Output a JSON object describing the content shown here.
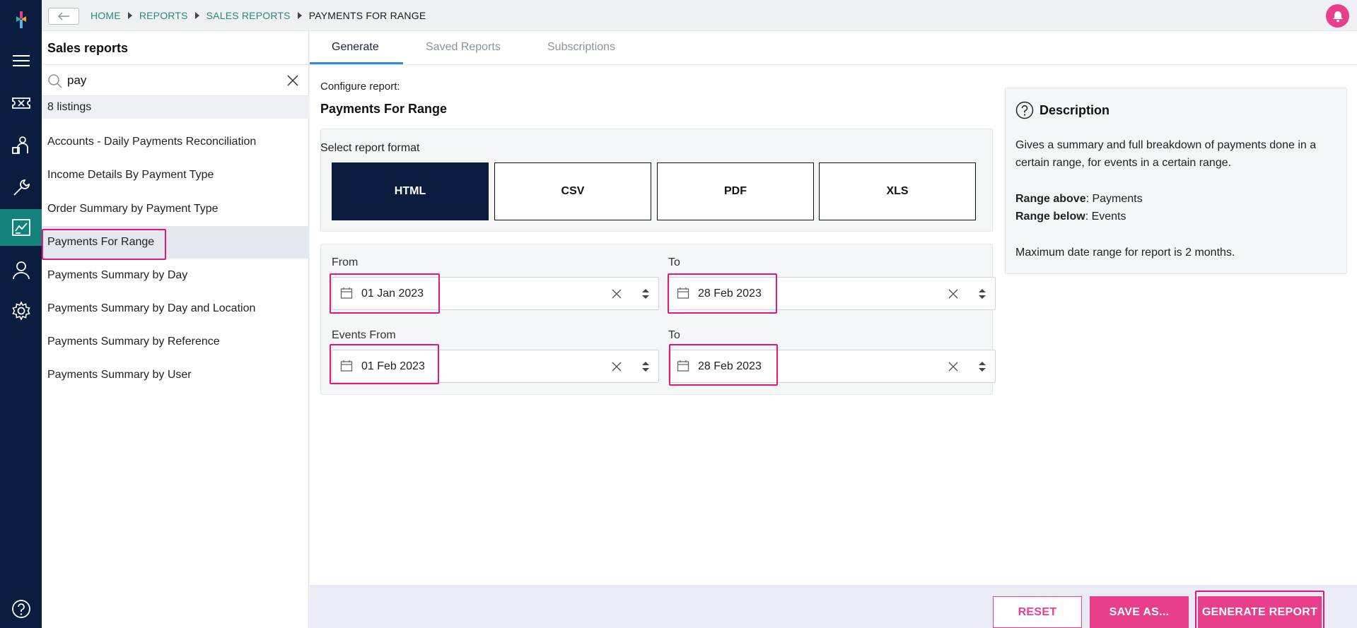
{
  "breadcrumb": {
    "items": [
      "HOME",
      "REPORTS",
      "SALES REPORTS"
    ],
    "current": "PAYMENTS FOR RANGE"
  },
  "sidebar": {
    "title": "Sales reports",
    "search": {
      "value": "pay",
      "placeholder": ""
    },
    "count": "8 listings",
    "items": [
      "Accounts - Daily Payments Reconciliation",
      "Income Details By Payment Type",
      "Order Summary by Payment Type",
      "Payments For Range",
      "Payments Summary by Day",
      "Payments Summary by Day and Location",
      "Payments Summary by Reference",
      "Payments Summary by User"
    ],
    "active_index": 3
  },
  "tabs": [
    "Generate",
    "Saved Reports",
    "Subscriptions"
  ],
  "config": {
    "label": "Configure report:",
    "title": "Payments For Range",
    "format_label": "Select report format",
    "formats": [
      "HTML",
      "CSV",
      "PDF",
      "XLS"
    ],
    "active_format": "HTML",
    "from_label": "From",
    "from_value": "01 Jan 2023",
    "to_label": "To",
    "to_value": "28 Feb 2023",
    "events_from_label": "Events From",
    "events_from_value": "01 Feb 2023",
    "events_to_label": "To",
    "events_to_value": "28 Feb 2023"
  },
  "description": {
    "title": "Description",
    "text1": "Gives a summary and full breakdown of payments done in a",
    "text2": "certain range, for events in a certain range.",
    "range_above_label": "Range above",
    "range_above_value": ": Payments",
    "range_below_label": "Range below",
    "range_below_value": ": Events",
    "max_range": "Maximum date range for report is 2 months."
  },
  "footer": {
    "reset": "RESET",
    "save_as": "SAVE AS...",
    "generate": "GENERATE REPORT"
  },
  "colors": {
    "rail": "#0b1d3f",
    "rail_active": "#14827a",
    "accent": "#e83e8c",
    "highlight": "#e0197a",
    "link": "#2a8a7d"
  }
}
